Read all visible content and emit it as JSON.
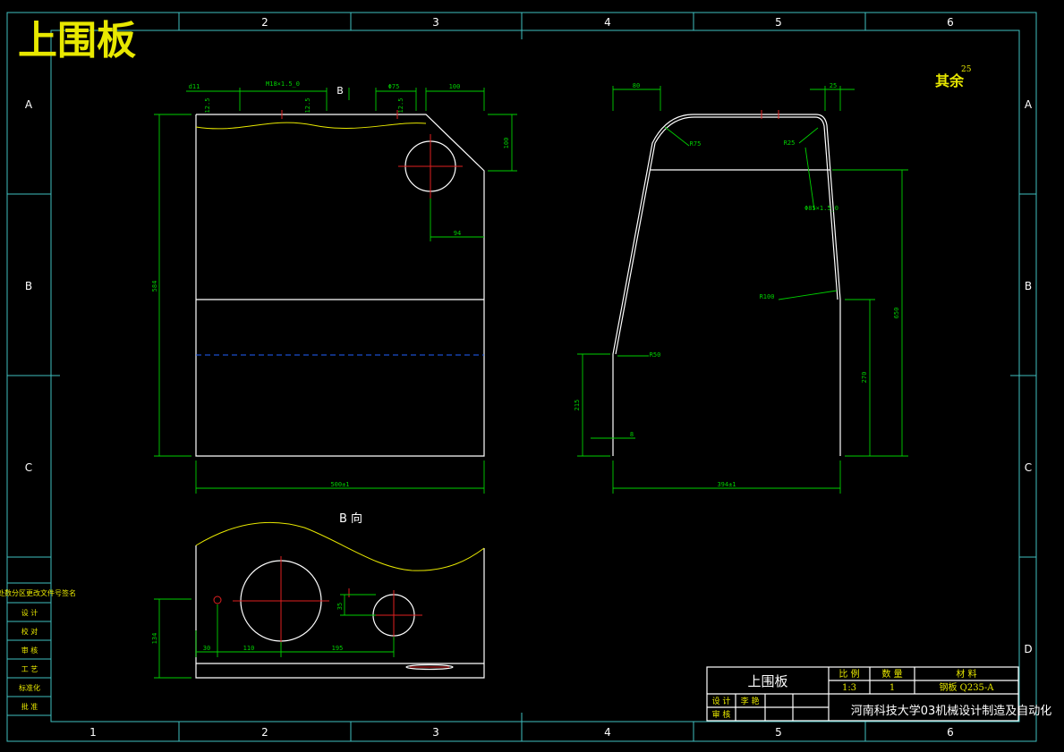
{
  "drawing_title": "上围板",
  "surface_note": "其余",
  "surface_note_value": "25",
  "col_labels": [
    "1",
    "2",
    "3",
    "4",
    "5",
    "6"
  ],
  "row_labels": [
    "A",
    "B",
    "C",
    "D"
  ],
  "view_b_label": "B",
  "view_b_direction_label": "B 向",
  "dims": {
    "front_width": "500±1",
    "front_height": "584",
    "hole_offset": "94",
    "chamfer_v": "100",
    "chamfer_h": "100",
    "top_d11": "d11",
    "top_m18": "M18×1.5_0",
    "top_phi75": "Φ75",
    "top_12_5a": "12.5",
    "top_12_5b": "12.5",
    "top_12_5c": "12.5",
    "side_width": "394±1",
    "side_80": "80",
    "side_25": "25",
    "side_r75": "R75",
    "side_r25": "R25",
    "side_r100": "R100",
    "side_r50": "R50",
    "side_650": "650",
    "side_270": "270",
    "side_215": "215",
    "side_8": "8",
    "side_tol": "Φ85×1.5_0",
    "bv_134": "134",
    "bv_30": "30",
    "bv_110": "110",
    "bv_195": "195",
    "bv_35": "35"
  },
  "left_table": [
    "标记处数分区更改文件号签名",
    "设 计",
    "校 对",
    "审 核",
    "工 艺",
    "标准化",
    "批 准"
  ],
  "title_block": {
    "part_name": "上围板",
    "h_scale": "比 例",
    "h_qty": "数 量",
    "h_material": "材 料",
    "scale": "1:3",
    "qty": "1",
    "material": "钢板 Q235-A",
    "designer_label": "设 计",
    "designer_name": "李 艳",
    "reviewer_label": "审 核",
    "school": "河南科技大学03机械设计制造及自动化"
  }
}
